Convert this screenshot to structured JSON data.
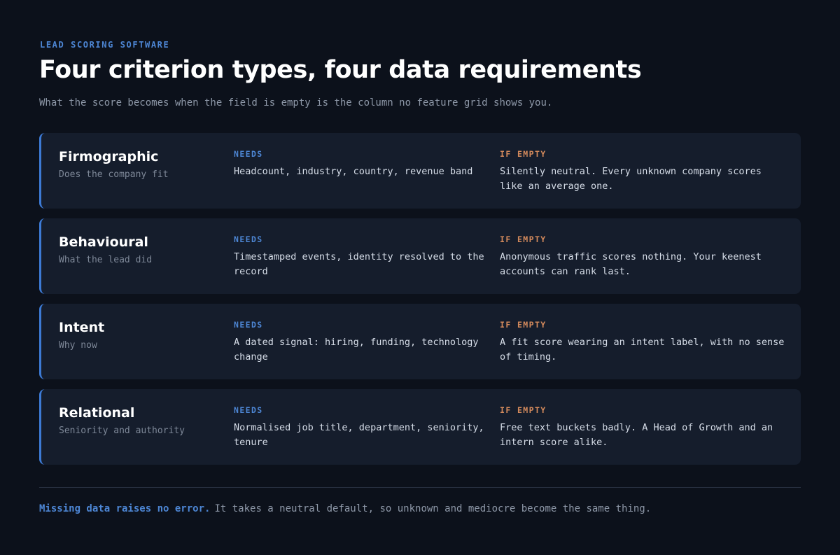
{
  "header": {
    "eyebrow": "LEAD SCORING SOFTWARE",
    "title": "Four criterion types, four data requirements",
    "subtitle": "What the score becomes when the field is empty is the column no feature grid shows you."
  },
  "column_labels": {
    "needs": "NEEDS",
    "if_empty": "IF EMPTY"
  },
  "criteria": [
    {
      "name": "Firmographic",
      "description": "Does the company fit",
      "needs": "Headcount, industry, country, revenue band",
      "if_empty": "Silently neutral. Every unknown company scores like an average one."
    },
    {
      "name": "Behavioural",
      "description": "What the lead did",
      "needs": "Timestamped events, identity resolved to the record",
      "if_empty": "Anonymous traffic scores nothing. Your keenest accounts can rank last."
    },
    {
      "name": "Intent",
      "description": "Why now",
      "needs": "A dated signal: hiring, funding, technology change",
      "if_empty": "A fit score wearing an intent label, with no sense of timing."
    },
    {
      "name": "Relational",
      "description": "Seniority and authority",
      "needs": "Normalised job title, department, seniority, tenure",
      "if_empty": "Free text buckets badly. A Head of Growth and an intern score alike."
    }
  ],
  "footer": {
    "emphasis": "Missing data raises no error.",
    "text": "It takes a neutral default, so unknown and mediocre become the same thing."
  },
  "colors": {
    "background": "#0c111b",
    "card": "#151d2c",
    "accent_blue": "#4d86d4",
    "accent_orange": "#d48a5c"
  }
}
